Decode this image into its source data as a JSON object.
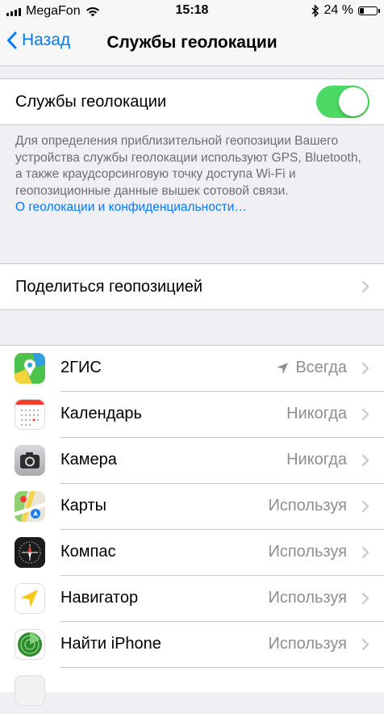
{
  "status_bar": {
    "carrier": "MegaFon",
    "time": "15:18",
    "battery_percent": "24 %",
    "battery_level": 0.24
  },
  "nav": {
    "back_label": "Назад",
    "title": "Службы геолокации"
  },
  "location_services": {
    "label": "Службы геолокации",
    "enabled": true,
    "footer_text": "Для определения приблизительной геопозиции Вашего устройства службы геолокации используют GPS, Bluetooth, а также краудсорсинговую точку доступа Wi-Fi и геопозиционные данные вышек сотовой связи.",
    "footer_link": "О геолокации и конфиденциальности…"
  },
  "share_location": {
    "label": "Поделиться геопозицией"
  },
  "apps": [
    {
      "name": "2ГИС",
      "status": "Всегда",
      "icon": "2gis-icon"
    },
    {
      "name": "Календарь",
      "status": "Никогда",
      "icon": "calendar-icon"
    },
    {
      "name": "Камера",
      "status": "Никогда",
      "icon": "camera-icon"
    },
    {
      "name": "Карты",
      "status": "Используя",
      "icon": "maps-icon"
    },
    {
      "name": "Компас",
      "status": "Используя",
      "icon": "compass-icon"
    },
    {
      "name": "Навигатор",
      "status": "Используя",
      "icon": "navigator-icon"
    },
    {
      "name": "Найти iPhone",
      "status": "Используя",
      "icon": "find-iphone-icon"
    }
  ],
  "colors": {
    "accent": "#007aff",
    "toggle_on": "#4cd964",
    "background": "#efeff4",
    "secondary_text": "#8e8e93"
  }
}
